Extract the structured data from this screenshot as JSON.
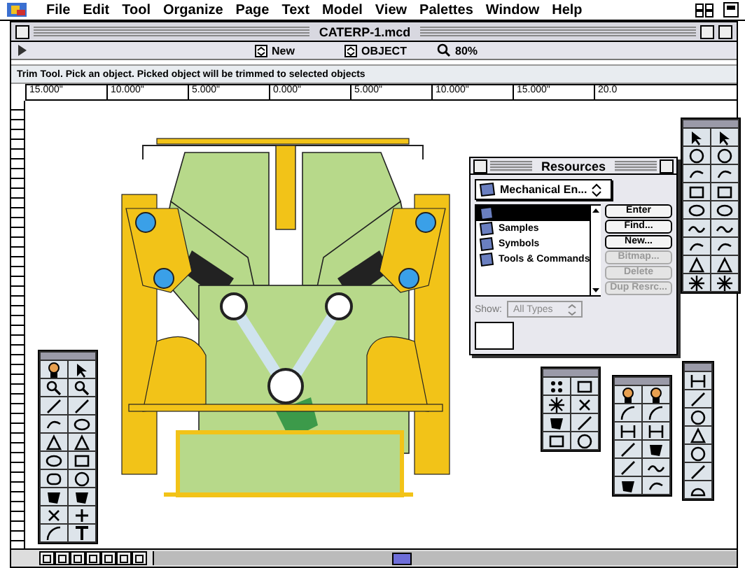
{
  "menu_bar": {
    "items": [
      "File",
      "Edit",
      "Tool",
      "Organize",
      "Page",
      "Text",
      "Model",
      "View",
      "Palettes",
      "Window",
      "Help"
    ]
  },
  "document": {
    "title": "CATERP-1.mcd",
    "toolbar": {
      "layer": "New",
      "class": "OBJECT",
      "zoom": "80%"
    },
    "status": "Trim Tool. Pick an object. Picked object will be trimmed to selected objects",
    "ruler": [
      "15.000\"",
      "10.000\"",
      "5.000\"",
      "0.000\"",
      "5.000\"",
      "10.000\"",
      "15.000\"",
      "20.0"
    ]
  },
  "resources": {
    "title": "Resources",
    "library": "Mechanical En...",
    "items": [
      {
        "selected": true
      },
      {
        "label": "Samples",
        "selected": false
      },
      {
        "label": "Symbols",
        "selected": false
      },
      {
        "label": "Tools & Commands",
        "selected": false
      }
    ],
    "buttons": [
      {
        "label": "Enter",
        "disabled": false
      },
      {
        "label": "Find...",
        "disabled": false
      },
      {
        "label": "New...",
        "disabled": false
      },
      {
        "label": "Bitmap...",
        "disabled": true
      },
      {
        "label": "Delete",
        "disabled": true
      },
      {
        "label": "Dup Resrc...",
        "disabled": true
      }
    ],
    "show_label": "Show:",
    "show_value": "All Types"
  }
}
